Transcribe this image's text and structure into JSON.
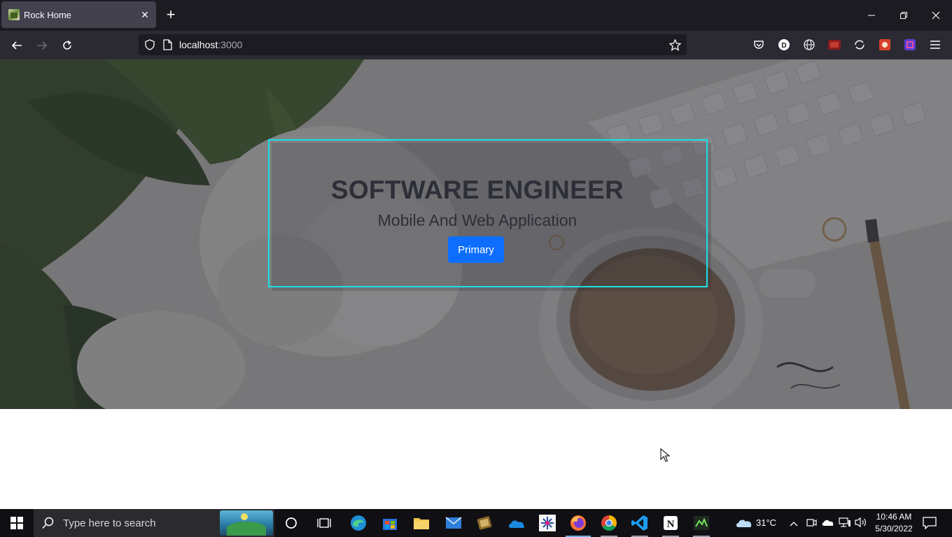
{
  "browser": {
    "tab_title": "Rock Home",
    "url_host": "localhost",
    "url_port": ":3000"
  },
  "hero": {
    "title": "SOFTWARE ENGINEER",
    "subtitle": "Mobile And Web Application",
    "button_label": "Primary"
  },
  "taskbar": {
    "search_placeholder": "Type here to search",
    "weather": "31°C",
    "time": "10:46 AM",
    "date": "5/30/2022"
  },
  "colors": {
    "hero_border": "#19e0e8",
    "primary_button": "#0d6efd",
    "browser_dark": "#1c1b22"
  }
}
